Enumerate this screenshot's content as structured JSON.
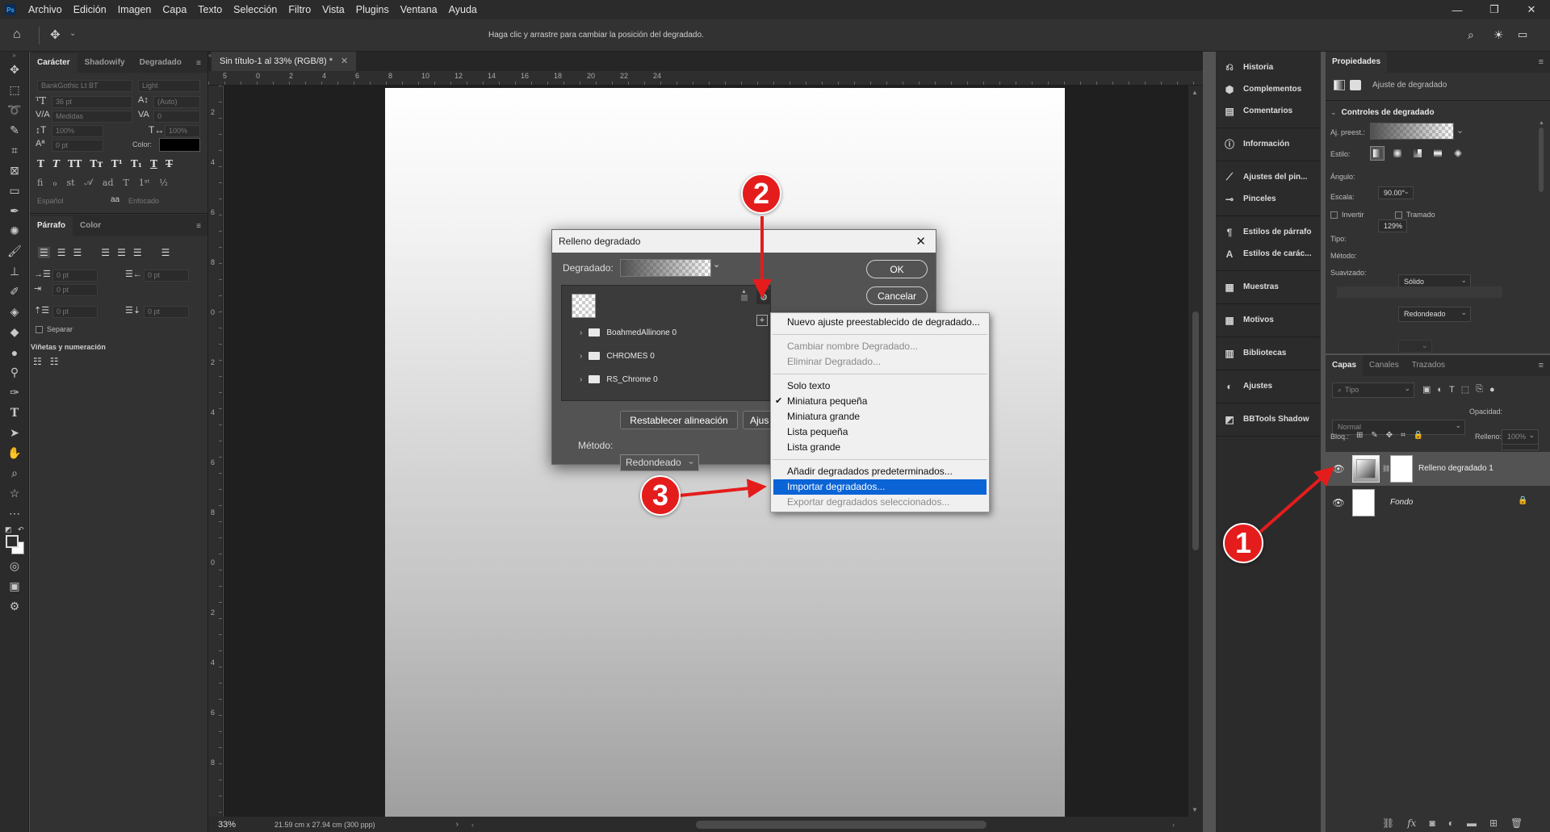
{
  "menubar": {
    "logo": "Ps",
    "items": [
      "Archivo",
      "Edición",
      "Imagen",
      "Capa",
      "Texto",
      "Selección",
      "Filtro",
      "Vista",
      "Plugins",
      "Ventana",
      "Ayuda"
    ]
  },
  "options": {
    "hint": "Haga clic y arrastre para cambiar la posición del degradado."
  },
  "character_panel": {
    "tabs": [
      "Carácter",
      "Shadowify",
      "Degradado"
    ],
    "font_family": "BankGothic Lt BT",
    "font_style": "Light",
    "size": "36 pt",
    "leading": "(Auto)",
    "kerning": "Medidas",
    "tracking": "0",
    "v_scale": "100%",
    "h_scale": "100%",
    "baseline": "0 pt",
    "color_label": "Color:",
    "language": "Español",
    "aa_label": "aa",
    "antialias": "Enfocado"
  },
  "paragraph_panel": {
    "tabs": [
      "Párrafo",
      "Color"
    ],
    "indent_left": "0 pt",
    "indent_right": "0 pt",
    "indent_first": "0 pt",
    "space_before": "0 pt",
    "space_after": "0 pt",
    "separar": "Separar",
    "bullets": "Viñetas y numeración"
  },
  "document": {
    "tab_title": "Sin título-1 al 33% (RGB/8) *",
    "zoom": "33%",
    "size_info": "21.59 cm x 27.94 cm (300 ppp)",
    "ruler_h": [
      "5",
      "0",
      "2",
      "4",
      "6",
      "8",
      "10",
      "12",
      "14",
      "16",
      "18",
      "20",
      "22",
      "24"
    ],
    "ruler_v": [
      "2",
      "4",
      "6",
      "8",
      "0",
      "2",
      "4",
      "6",
      "8",
      "0",
      "2",
      "4",
      "6",
      "8"
    ]
  },
  "dock": {
    "groups": [
      [
        {
          "label": "Historia",
          "icon": "history-icon"
        },
        {
          "label": "Complementos",
          "icon": "plugins-icon"
        },
        {
          "label": "Comentarios",
          "icon": "comments-icon"
        }
      ],
      [
        {
          "label": "Información",
          "icon": "info-icon"
        }
      ],
      [
        {
          "label": "Ajustes del pin...",
          "icon": "brush-settings-icon"
        },
        {
          "label": "Pinceles",
          "icon": "brushes-icon"
        }
      ],
      [
        {
          "label": "Estilos de párrafo",
          "icon": "paragraph-styles-icon"
        },
        {
          "label": "Estilos de carác...",
          "icon": "char-styles-icon"
        }
      ],
      [
        {
          "label": "Muestras",
          "icon": "swatches-icon"
        }
      ],
      [
        {
          "label": "Motivos",
          "icon": "patterns-icon"
        }
      ],
      [
        {
          "label": "Bibliotecas",
          "icon": "libraries-icon"
        }
      ],
      [
        {
          "label": "Ajustes",
          "icon": "adjustments-icon"
        }
      ],
      [
        {
          "label": "BBTools Shadow",
          "icon": "bbtools-icon"
        }
      ]
    ]
  },
  "properties": {
    "title": "Propiedades",
    "subtitle": "Ajuste de degradado",
    "section": "Controles de degradado",
    "preset_label": "Aj. preest.:",
    "style_label": "Estilo:",
    "angle_label": "Ángulo:",
    "angle": "90.00°",
    "scale_label": "Escala:",
    "scale": "129%",
    "invert": "Invertir",
    "dither": "Tramado",
    "type_label": "Tipo:",
    "type": "Sólido",
    "method_label": "Método:",
    "method": "Redondeado",
    "smooth_label": "Suavizado:"
  },
  "layers": {
    "tabs": [
      "Capas",
      "Canales",
      "Trazados"
    ],
    "filter": "Tipo",
    "blend": "Normal",
    "opacity_label": "Opacidad:",
    "opacity": "100%",
    "lock_label": "Bloq.:",
    "fill_label": "Relleno:",
    "fill": "100%",
    "items": [
      {
        "name": "Relleno degradado 1",
        "selected": true
      },
      {
        "name": "Fondo",
        "selected": false
      }
    ]
  },
  "dialog": {
    "title": "Relleno degradado",
    "gradient_label": "Degradado:",
    "ok": "OK",
    "cancel": "Cancelar",
    "folders": [
      "BoahmedAllinone 0",
      "CHROMES 0",
      "RS_Chrome 0"
    ],
    "reset_align": "Restablecer alineación",
    "adjust_partial": "Ajus",
    "method_label": "Método:",
    "method": "Redondeado"
  },
  "context_menu": {
    "items": [
      {
        "label": "Nuevo ajuste preestablecido de degradado...",
        "state": "normal"
      },
      {
        "sep": true
      },
      {
        "label": "Cambiar nombre Degradado...",
        "state": "disabled"
      },
      {
        "label": "Eliminar Degradado...",
        "state": "disabled"
      },
      {
        "sep": true
      },
      {
        "label": "Solo texto",
        "state": "normal"
      },
      {
        "label": "Miniatura pequeña",
        "state": "checked"
      },
      {
        "label": "Miniatura grande",
        "state": "normal"
      },
      {
        "label": "Lista pequeña",
        "state": "normal"
      },
      {
        "label": "Lista grande",
        "state": "normal"
      },
      {
        "sep": true
      },
      {
        "label": "Añadir degradados predeterminados...",
        "state": "normal"
      },
      {
        "label": "Importar degradados...",
        "state": "selected"
      },
      {
        "label": "Exportar degradados seleccionados...",
        "state": "disabled"
      }
    ]
  },
  "annotations": {
    "badge1": "1",
    "badge2": "2",
    "badge3": "3",
    "color": "#e51c1c"
  }
}
